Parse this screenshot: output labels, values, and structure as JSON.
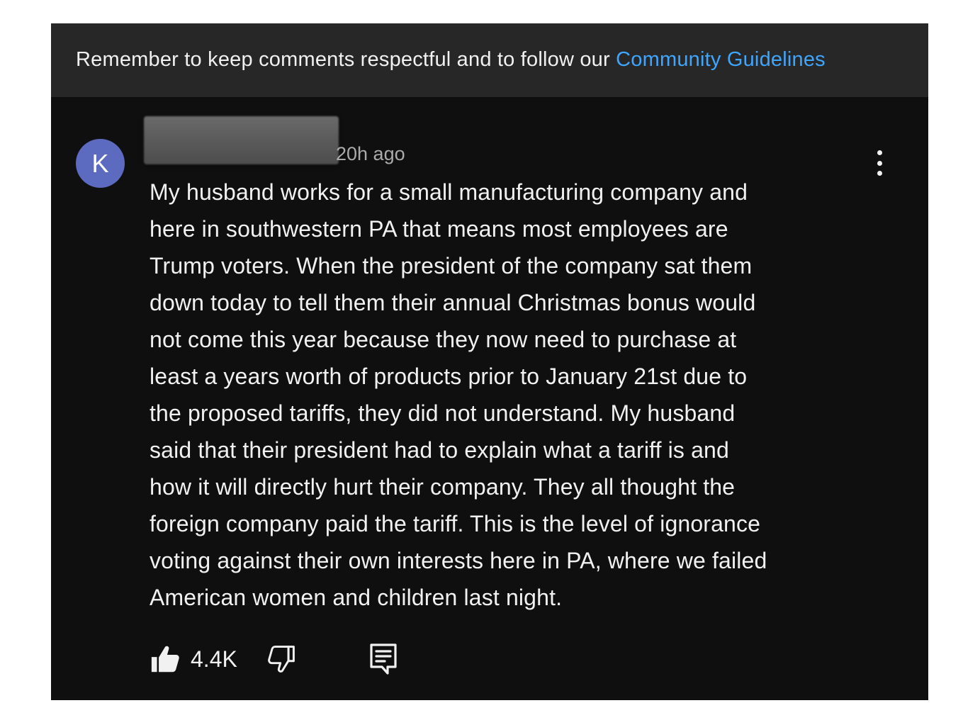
{
  "banner": {
    "text": "Remember to keep comments respectful and to follow our ",
    "link_label": "Community Guidelines",
    "link_color": "#3ea6ff"
  },
  "comment": {
    "avatar_initial": "K",
    "avatar_color": "#5c6bc0",
    "timestamp": "20h ago",
    "body_lines": [
      "My husband works for a small manufacturing company and",
      "here in southwestern PA that means most employees are",
      "Trump voters. When the president of the company sat them",
      "down today to tell them their annual Christmas bonus would",
      "not come this year because they now need to purchase at",
      "least a years worth of products prior to January 21st due to",
      "the proposed tariffs, they did not understand. My husband",
      "said that their president had to explain what a tariff is and",
      "how it will directly hurt their company. They all thought the",
      "foreign company paid the tariff. This is the level of ignorance",
      "voting against their own interests here in PA, where we failed",
      "American women and children last night."
    ],
    "like_count": "4.4K",
    "icons": {
      "like": "thumbs-up-icon",
      "dislike": "thumbs-down-icon",
      "reply": "reply-comment-icon",
      "menu": "more-vertical-icon"
    }
  }
}
